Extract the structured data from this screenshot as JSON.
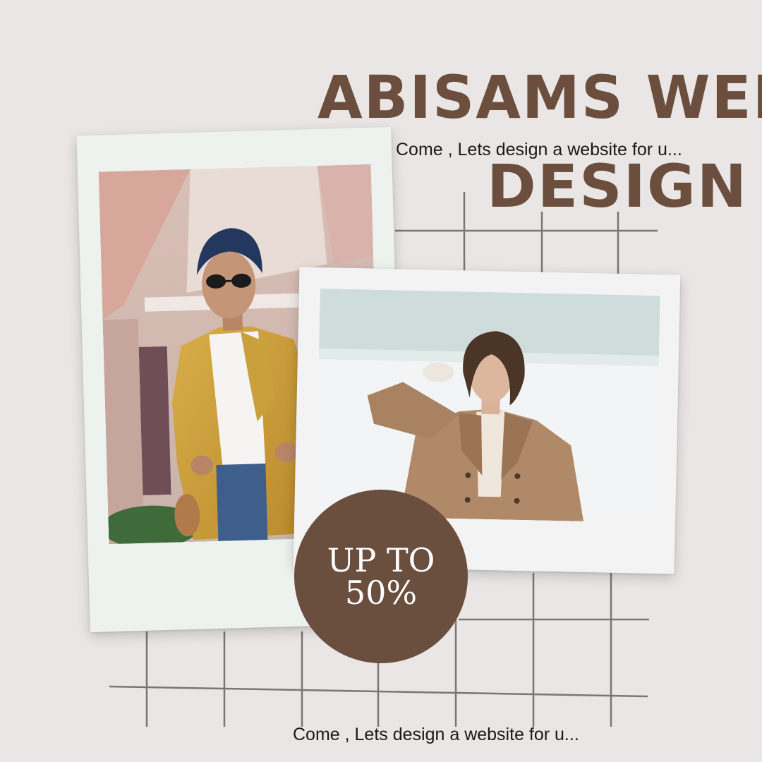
{
  "headline": {
    "line1": "ABISAMS WEB",
    "line2": "DESIGN"
  },
  "tagline_top": "Come , Lets design a website for u...",
  "tagline_bottom": "Come , Lets design a website for u...",
  "badge": {
    "line1": "UP TO",
    "line2": "50%"
  },
  "colors": {
    "background": "#e9e6e5",
    "brand_brown": "#6b4e3d",
    "badge_brown": "#6a4e3e",
    "grid_gray": "#7a7675"
  }
}
